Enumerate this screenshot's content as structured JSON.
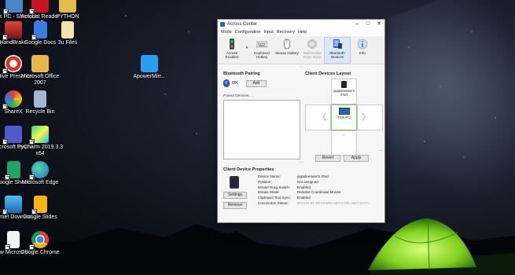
{
  "desktop": {
    "icons": [
      {
        "label": "This PC - Shortcut"
      },
      {
        "label": "Acrobat Reader DC"
      },
      {
        "label": "PYTHON"
      },
      {
        "label": "HandBrake"
      },
      {
        "label": "Google Docs"
      },
      {
        "label": "3u Files"
      },
      {
        "label": "Active Presenter"
      },
      {
        "label": "Microsoft Office 2007"
      },
      {
        "label": "ApowerMirr..."
      },
      {
        "label": "ShareX"
      },
      {
        "label": "Recycle Bin"
      },
      {
        "label": "Microsoft Teams"
      },
      {
        "label": "PyCharm 2019.3.3 x64"
      },
      {
        "label": "Google Sheets"
      },
      {
        "label": "Microsoft Edge"
      },
      {
        "label": "Internet Downloa..."
      },
      {
        "label": "Google Slides"
      },
      {
        "label": "New Microsoft ..."
      },
      {
        "label": "Google Chrome"
      }
    ]
  },
  "window": {
    "title": "Across Center",
    "menu": [
      "Mode",
      "Configuration",
      "Input",
      "Recovery",
      "Help"
    ],
    "toolbar": [
      {
        "label": "Across Enabled",
        "icon": "power-switch-icon"
      },
      {
        "label": "Keyboard Hotkey",
        "icon": "keyboard-icon"
      },
      {
        "label": "Mouse Hotkey",
        "icon": "mouse-icon"
      },
      {
        "label": "Multimedia Keys Input",
        "icon": "multimedia-icon",
        "disabled": true
      },
      {
        "label": "Bluetooth Devices",
        "icon": "bluetooth-devices-icon",
        "selected": true
      },
      {
        "label": "Info",
        "icon": "info-icon"
      }
    ],
    "dropdown_glyph": "▾",
    "separator_glyph": "...",
    "bluetooth": {
      "title": "Bluetooth Pairing",
      "status": "ON",
      "add_label": "Add",
      "paired_label": "Paired Devices: ..."
    },
    "layout": {
      "title": "Client Devices Layout",
      "top_device": "jagadeeswar's iPad",
      "center_device": "This PC",
      "more": "...",
      "revert_label": "Revert",
      "apply_label": "Apply"
    },
    "properties": {
      "title": "Client Device Properties",
      "settings_label": "Settings",
      "remove_label": "Remove",
      "rows": [
        {
          "key": "Device Name:",
          "value": "jagadeeswar's iPad"
        },
        {
          "key": "Position:",
          "value": "Not assigned"
        },
        {
          "key": "Mouse Drag Switch:",
          "value": "Enabled"
        },
        {
          "key": "Mouse Mode:",
          "value": "Relative Coordinate Mouse"
        },
        {
          "key": "Clipboard Text Sync:",
          "value": "Enabled"
        },
        {
          "key": "Connection Status:",
          "value": "BT-HID  BT-RFCOMM  NET-CTRL  NET-DATA"
        }
      ]
    }
  }
}
